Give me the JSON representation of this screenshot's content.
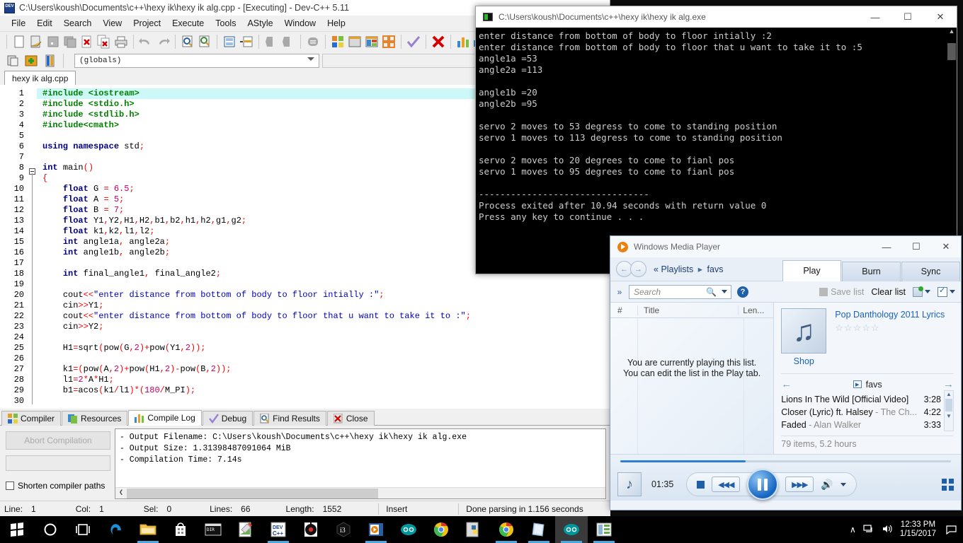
{
  "devcpp": {
    "title": "C:\\Users\\koush\\Documents\\c++\\hexy ik\\hexy ik alg.cpp - [Executing] - Dev-C++ 5.11",
    "menus": [
      "File",
      "Edit",
      "Search",
      "View",
      "Project",
      "Execute",
      "Tools",
      "AStyle",
      "Window",
      "Help"
    ],
    "combo_value": "(globals)",
    "tab_label": "hexy ik alg.cpp",
    "code_lines": [
      {
        "n": 1,
        "html": "<span class='k-pre'>#include &lt;iostream&gt;</span>",
        "hl": true
      },
      {
        "n": 2,
        "html": "<span class='k-pre'>#include &lt;stdio.h&gt;</span>",
        "hl": false
      },
      {
        "n": 3,
        "html": "<span class='k-pre'>#include &lt;stdlib.h&gt;</span>",
        "hl": false
      },
      {
        "n": 4,
        "html": "<span class='k-pre'>#include&lt;cmath&gt;</span>",
        "hl": false
      },
      {
        "n": 5,
        "html": "",
        "hl": false
      },
      {
        "n": 6,
        "html": "<span class='k-kw'>using namespace</span> <span class='k-id'>std</span><span class='k-sym'>;</span>",
        "hl": false
      },
      {
        "n": 7,
        "html": "",
        "hl": false
      },
      {
        "n": 8,
        "html": "<span class='k-kw'>int</span> <span class='k-id'>main</span><span class='k-fn'>()</span>",
        "hl": false
      },
      {
        "n": 9,
        "html": "<span class='k-fn'>{</span>",
        "hl": false
      },
      {
        "n": 10,
        "html": "    <span class='k-kw'>float</span> G <span class='k-sym'>=</span> <span class='k-num'>6.5</span><span class='k-sym'>;</span>",
        "hl": false
      },
      {
        "n": 11,
        "html": "    <span class='k-kw'>float</span> A <span class='k-sym'>=</span> <span class='k-num'>5</span><span class='k-sym'>;</span>",
        "hl": false
      },
      {
        "n": 12,
        "html": "    <span class='k-kw'>float</span> B <span class='k-sym'>=</span> <span class='k-num'>7</span><span class='k-sym'>;</span>",
        "hl": false
      },
      {
        "n": 13,
        "html": "    <span class='k-kw'>float</span> Y1<span class='k-sym'>,</span>Y2<span class='k-sym'>,</span>H1<span class='k-sym'>,</span>H2<span class='k-sym'>,</span>b1<span class='k-sym'>,</span>b2<span class='k-sym'>,</span>h1<span class='k-sym'>,</span>h2<span class='k-sym'>,</span>g1<span class='k-sym'>,</span>g2<span class='k-sym'>;</span>",
        "hl": false
      },
      {
        "n": 14,
        "html": "    <span class='k-kw'>float</span> k1<span class='k-sym'>,</span>k2<span class='k-sym'>,</span>l1<span class='k-sym'>,</span>l2<span class='k-sym'>;</span>",
        "hl": false
      },
      {
        "n": 15,
        "html": "    <span class='k-kw'>int</span> angle1a<span class='k-sym'>,</span> angle2a<span class='k-sym'>;</span>",
        "hl": false
      },
      {
        "n": 16,
        "html": "    <span class='k-kw'>int</span> angle1b<span class='k-sym'>,</span> angle2b<span class='k-sym'>;</span>",
        "hl": false
      },
      {
        "n": 17,
        "html": "",
        "hl": false
      },
      {
        "n": 18,
        "html": "    <span class='k-kw'>int</span> final_angle1<span class='k-sym'>,</span> final_angle2<span class='k-sym'>;</span>",
        "hl": false
      },
      {
        "n": 19,
        "html": "",
        "hl": false
      },
      {
        "n": 20,
        "html": "    <span class='k-id'>cout</span><span class='k-sym'>&lt;&lt;</span><span class='k-str'>\"enter distance from bottom of body to floor intially :\"</span><span class='k-sym'>;</span>",
        "hl": false
      },
      {
        "n": 21,
        "html": "    <span class='k-id'>cin</span><span class='k-sym'>&gt;&gt;</span><span class='k-id'>Y1</span><span class='k-sym'>;</span>",
        "hl": false
      },
      {
        "n": 22,
        "html": "    <span class='k-id'>cout</span><span class='k-sym'>&lt;&lt;</span><span class='k-str'>\"enter distance from bottom of body to floor that u want to take it to :\"</span><span class='k-sym'>;</span>",
        "hl": false
      },
      {
        "n": 23,
        "html": "    <span class='k-id'>cin</span><span class='k-sym'>&gt;&gt;</span><span class='k-id'>Y2</span><span class='k-sym'>;</span>",
        "hl": false
      },
      {
        "n": 24,
        "html": "",
        "hl": false
      },
      {
        "n": 25,
        "html": "    H1<span class='k-sym'>=</span>sqrt<span class='k-sym'>(</span>pow<span class='k-sym'>(</span>G<span class='k-sym'>,</span><span class='k-num'>2</span><span class='k-sym'>)+</span>pow<span class='k-sym'>(</span>Y1<span class='k-sym'>,</span><span class='k-num'>2</span><span class='k-sym'>));</span>",
        "hl": false
      },
      {
        "n": 26,
        "html": "",
        "hl": false
      },
      {
        "n": 27,
        "html": "    k1<span class='k-sym'>=(</span>pow<span class='k-sym'>(</span>A<span class='k-sym'>,</span><span class='k-num'>2</span><span class='k-sym'>)+</span>pow<span class='k-sym'>(</span>H1<span class='k-sym'>,</span><span class='k-num'>2</span><span class='k-sym'>)-</span>pow<span class='k-sym'>(</span>B<span class='k-sym'>,</span><span class='k-num'>2</span><span class='k-sym'>));</span>",
        "hl": false
      },
      {
        "n": 28,
        "html": "    l1<span class='k-sym'>=</span><span class='k-num'>2</span><span class='k-sym'>*</span>A<span class='k-sym'>*</span>H1<span class='k-sym'>;</span>",
        "hl": false
      },
      {
        "n": 29,
        "html": "    b1<span class='k-sym'>=</span>acos<span class='k-sym'>(</span>k1<span class='k-sym'>/</span>l1<span class='k-sym'>)*(</span><span class='k-num'>180</span><span class='k-sym'>/</span>M_PI<span class='k-sym'>);</span>",
        "hl": false
      },
      {
        "n": 30,
        "html": "",
        "hl": false
      }
    ],
    "bottom_tabs": [
      {
        "label": "Compiler",
        "icon": "compiler-icon",
        "active": false
      },
      {
        "label": "Resources",
        "icon": "resources-icon",
        "active": false
      },
      {
        "label": "Compile Log",
        "icon": "compile-log-icon",
        "active": true
      },
      {
        "label": "Debug",
        "icon": "debug-icon",
        "active": false
      },
      {
        "label": "Find Results",
        "icon": "find-results-icon",
        "active": false
      },
      {
        "label": "Close",
        "icon": "close-panel-icon",
        "active": false
      }
    ],
    "abort_button": "Abort Compilation",
    "shorten_paths_label": "Shorten compiler paths",
    "log_lines": [
      "- Output Filename: C:\\Users\\koush\\Documents\\c++\\hexy ik\\hexy ik alg.exe",
      "- Output Size: 1.31398487091064 MiB",
      "- Compilation Time: 7.14s"
    ],
    "status": {
      "line_label": "Line:",
      "line_value": "1",
      "col_label": "Col:",
      "col_value": "1",
      "sel_label": "Sel:",
      "sel_value": "0",
      "lines_label": "Lines:",
      "lines_value": "66",
      "length_label": "Length:",
      "length_value": "1552",
      "mode": "Insert",
      "message": "Done parsing in 1.156 seconds"
    }
  },
  "console": {
    "title": "C:\\Users\\koush\\Documents\\c++\\hexy ik\\hexy ik alg.exe",
    "output": "enter distance from bottom of body to floor intially :2\nenter distance from bottom of body to floor that u want to take it to :5\nangle1a =53\nangle2a =113\n\nangle1b =20\nangle2b =95\n\nservo 2 moves to 53 degress to come to standing position\nservo 1 moves to 113 degress to come to standing position\n\nservo 2 moves to 20 degrees to come to fianl pos\nservo 1 moves to 95 degrees to come to fianl pos\n\n--------------------------------\nProcess exited after 10.94 seconds with return value 0\nPress any key to continue . . .",
    "buttons": {
      "minimize": "—",
      "maximize": "☐",
      "close": "✕"
    }
  },
  "wmp": {
    "title": "Windows Media Player",
    "buttons": {
      "minimize": "—",
      "maximize": "☐",
      "close": "✕"
    },
    "breadcrumb_root": "Playlists",
    "breadcrumb_current": "favs",
    "back_prefix": "«",
    "tabs": [
      {
        "label": "Play",
        "active": true
      },
      {
        "label": "Burn",
        "active": false
      },
      {
        "label": "Sync",
        "active": false
      }
    ],
    "search_placeholder": "Search",
    "save_list": "Save list",
    "clear_list": "Clear list",
    "list_columns": [
      "#",
      "Title",
      "Len..."
    ],
    "list_message": "You are currently playing this list.  You can edit the list in the Play tab.",
    "album_title": "Pop Danthology 2011 Lyrics",
    "rating_stars": "☆☆☆☆☆",
    "shop_label": "Shop",
    "playlist_name": "favs",
    "tracks": [
      {
        "title": "Lions In The Wild [Official Video]",
        "artist": "",
        "length": "3:28"
      },
      {
        "title": "Closer (Lyric) ft. Halsey",
        "artist": " - The Ch...",
        "length": "4:22"
      },
      {
        "title": "Faded",
        "artist": " - Alan Walker",
        "length": "3:33"
      }
    ],
    "items_summary": "79 items, 5.2 hours",
    "current_time": "01:35",
    "progress_pct": 38
  },
  "taskbar": {
    "start_icon": "windows-start-icon",
    "items": [
      {
        "name": "cortana-search-icon",
        "running": false,
        "active": false
      },
      {
        "name": "task-view-icon",
        "running": false,
        "active": false
      },
      {
        "name": "edge-icon",
        "running": false,
        "active": false
      },
      {
        "name": "file-explorer-icon",
        "running": true,
        "active": false
      },
      {
        "name": "microsoft-store-icon",
        "running": false,
        "active": false
      },
      {
        "name": "command-prompt-icon",
        "running": false,
        "active": false
      },
      {
        "name": "notepad-plus-icon",
        "running": false,
        "active": false
      },
      {
        "name": "devcpp-icon",
        "running": true,
        "active": false
      },
      {
        "name": "target-app-icon",
        "running": false,
        "active": false
      },
      {
        "name": "processing-icon",
        "running": false,
        "active": false
      },
      {
        "name": "media-player-icon",
        "running": true,
        "active": false
      },
      {
        "name": "arduino-icon",
        "running": false,
        "active": false
      },
      {
        "name": "chrome-icon",
        "running": false,
        "active": false
      },
      {
        "name": "python-idle-icon",
        "running": false,
        "active": false
      },
      {
        "name": "chrome-window-icon",
        "running": true,
        "active": false
      },
      {
        "name": "sticky-notes-icon",
        "running": true,
        "active": false
      },
      {
        "name": "arduino-window-icon",
        "running": true,
        "active": true
      },
      {
        "name": "presentation-icon",
        "running": true,
        "active": false
      }
    ],
    "tray": {
      "chevron": "∧",
      "network": "network-icon",
      "volume": "volume-icon",
      "time": "12:33 PM",
      "date": "1/15/2017",
      "action_center": "action-center-icon"
    }
  },
  "colors": {
    "accent": "#1f5fa8",
    "taskbar": "#000000",
    "console_bg": "#000000",
    "console_fg": "#cccccc",
    "highlight_line": "#ccf8f8"
  }
}
